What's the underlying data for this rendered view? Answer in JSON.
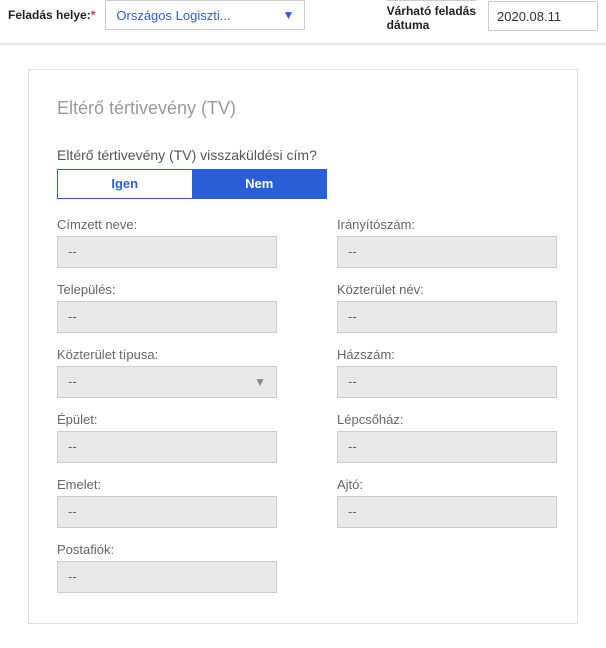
{
  "topbar": {
    "posting_place_label": "Feladás helye:",
    "posting_place_value": "Országos Logiszti...",
    "date_label_line1": "Várható feladás",
    "date_label_line2": "dátuma",
    "date_value": "2020.08.11"
  },
  "card": {
    "title": "Eltérő tértivevény (TV)",
    "question": "Eltérő tértivevény (TV) visszaküldési cím?",
    "yes_label": "Igen",
    "no_label": "Nem"
  },
  "fields": {
    "cimzett_neve": {
      "label": "Címzett neve:",
      "value": "--"
    },
    "iranyitoszam": {
      "label": "Irányítószám:",
      "value": "--"
    },
    "telepules": {
      "label": "Település:",
      "value": "--"
    },
    "kozterulet_nev": {
      "label": "Közterület név:",
      "value": "--"
    },
    "kozterulet_tipusa": {
      "label": "Közterület típusa:",
      "value": "--"
    },
    "hazszam": {
      "label": "Házszám:",
      "value": "--"
    },
    "epulet": {
      "label": "Épület:",
      "value": "--"
    },
    "lepcsohaz": {
      "label": "Lépcsőház:",
      "value": "--"
    },
    "emelet": {
      "label": "Emelet:",
      "value": "--"
    },
    "ajto": {
      "label": "Ajtó:",
      "value": "--"
    },
    "postafiok": {
      "label": "Postafiók:",
      "value": "--"
    }
  }
}
